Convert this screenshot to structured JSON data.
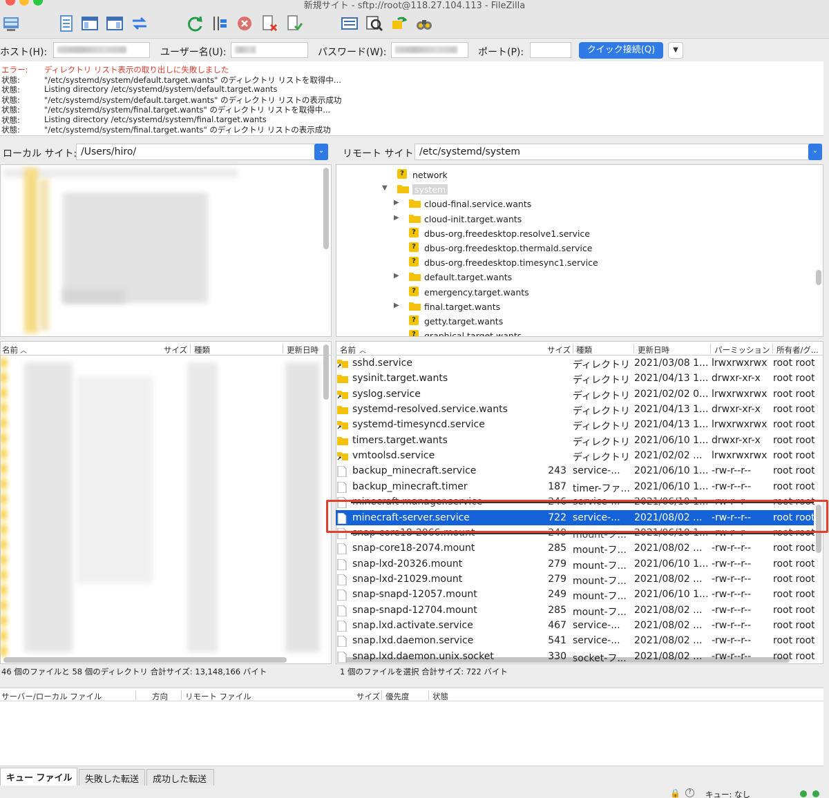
{
  "window": {
    "title": "新規サイト - sftp://root@118.27.104.113 - FileZilla"
  },
  "toolbar": {
    "icons": [
      "site-manager-icon",
      "message-log-icon",
      "local-tree-icon",
      "remote-tree-icon",
      "transfer-queue-icon",
      "refresh-icon",
      "process-queue-icon",
      "cancel-icon",
      "disconnect-icon",
      "reconnect-icon",
      "filter-icon",
      "compare-icon",
      "sync-browse-icon",
      "search-icon"
    ]
  },
  "quickconnect": {
    "host_label": "ホスト(H):",
    "user_label": "ユーザー名(U):",
    "password_label": "パスワード(W):",
    "port_label": "ポート(P):",
    "port_value": "",
    "connect_button": "クイック接続(Q)"
  },
  "log": [
    {
      "type": "エラー:",
      "msg": "ディレクトリ リスト表示の取り出しに失敗しました",
      "error": true
    },
    {
      "type": "状態:",
      "msg": "\"/etc/systemd/system/default.target.wants\" のディレクトリ リストを取得中...",
      "error": false
    },
    {
      "type": "状態:",
      "msg": "Listing directory /etc/systemd/system/default.target.wants",
      "error": false
    },
    {
      "type": "状態:",
      "msg": "\"/etc/systemd/system/default.target.wants\" のディレクトリ リストの表示成功",
      "error": false
    },
    {
      "type": "状態:",
      "msg": "\"/etc/systemd/system/final.target.wants\" のディレクトリ リストを取得中...",
      "error": false
    },
    {
      "type": "状態:",
      "msg": "Listing directory /etc/systemd/system/final.target.wants",
      "error": false
    },
    {
      "type": "状態:",
      "msg": "\"/etc/systemd/system/final.target.wants\" のディレクトリ リストの表示成功",
      "error": false
    }
  ],
  "local": {
    "site_label": "ローカル サイト:",
    "path": "/Users/hiro/",
    "columns": {
      "name": "名前",
      "size": "サイズ",
      "type": "種類",
      "modified": "更新日時"
    },
    "status": "46 個のファイルと 58 個のディレクトリ 合計サイズ: 13,148,166 バイト"
  },
  "remote": {
    "site_label": "リモート サイト:",
    "path": "/etc/systemd/system",
    "tree": [
      {
        "label": "network",
        "icon": "question",
        "indent": 0,
        "arrow": ""
      },
      {
        "label": "system",
        "icon": "folder",
        "indent": 0,
        "arrow": "down",
        "selected": true
      },
      {
        "label": "cloud-final.service.wants",
        "icon": "folder",
        "indent": 1,
        "arrow": "right"
      },
      {
        "label": "cloud-init.target.wants",
        "icon": "folder",
        "indent": 1,
        "arrow": "right"
      },
      {
        "label": "dbus-org.freedesktop.resolve1.service",
        "icon": "question",
        "indent": 1,
        "arrow": ""
      },
      {
        "label": "dbus-org.freedesktop.thermald.service",
        "icon": "question",
        "indent": 1,
        "arrow": ""
      },
      {
        "label": "dbus-org.freedesktop.timesync1.service",
        "icon": "question",
        "indent": 1,
        "arrow": ""
      },
      {
        "label": "default.target.wants",
        "icon": "folder",
        "indent": 1,
        "arrow": "right"
      },
      {
        "label": "emergency.target.wants",
        "icon": "question",
        "indent": 1,
        "arrow": ""
      },
      {
        "label": "final.target.wants",
        "icon": "folder",
        "indent": 1,
        "arrow": "right"
      },
      {
        "label": "getty.target.wants",
        "icon": "question",
        "indent": 1,
        "arrow": ""
      },
      {
        "label": "graphical.target.wants",
        "icon": "question",
        "indent": 1,
        "arrow": ""
      }
    ],
    "columns": {
      "name": "名前",
      "size": "サイズ",
      "type": "種類",
      "modified": "更新日時",
      "perms": "パーミッション",
      "owner": "所有者/グ..."
    },
    "files": [
      {
        "name": "sshd.service",
        "icon": "symlink",
        "size": "",
        "type": "ディレクトリ",
        "modified": "2021/03/08 1...",
        "perms": "lrwxrwxrwx",
        "owner": "root root"
      },
      {
        "name": "sysinit.target.wants",
        "icon": "folder",
        "size": "",
        "type": "ディレクトリ",
        "modified": "2021/04/13 1...",
        "perms": "drwxr-xr-x",
        "owner": "root root"
      },
      {
        "name": "syslog.service",
        "icon": "symlink",
        "size": "",
        "type": "ディレクトリ",
        "modified": "2021/02/02 0...",
        "perms": "lrwxrwxrwx",
        "owner": "root root"
      },
      {
        "name": "systemd-resolved.service.wants",
        "icon": "folder",
        "size": "",
        "type": "ディレクトリ",
        "modified": "2021/04/13 1...",
        "perms": "drwxr-xr-x",
        "owner": "root root"
      },
      {
        "name": "systemd-timesyncd.service",
        "icon": "symlink",
        "size": "",
        "type": "ディレクトリ",
        "modified": "2021/04/13 1...",
        "perms": "lrwxrwxrwx",
        "owner": "root root"
      },
      {
        "name": "timers.target.wants",
        "icon": "folder",
        "size": "",
        "type": "ディレクトリ",
        "modified": "2021/06/10 1...",
        "perms": "drwxr-xr-x",
        "owner": "root root"
      },
      {
        "name": "vmtoolsd.service",
        "icon": "symlink",
        "size": "",
        "type": "ディレクトリ",
        "modified": "2021/02/02 ...",
        "perms": "lrwxrwxrwx",
        "owner": "root root"
      },
      {
        "name": "backup_minecraft.service",
        "icon": "file",
        "size": "243",
        "type": "service-...",
        "modified": "2021/06/10 1...",
        "perms": "-rw-r--r--",
        "owner": "root root"
      },
      {
        "name": "backup_minecraft.timer",
        "icon": "file",
        "size": "187",
        "type": "timer-ファ...",
        "modified": "2021/06/10 1...",
        "perms": "-rw-r--r--",
        "owner": "root root"
      },
      {
        "name": "minecraft-manager.service",
        "icon": "file",
        "size": "246",
        "type": "service-...",
        "modified": "2021/06/10 1...",
        "perms": "-rw-r--r--",
        "owner": "root root",
        "strike": true
      },
      {
        "name": "minecraft-server.service",
        "icon": "file",
        "size": "722",
        "type": "service-...",
        "modified": "2021/08/02 ...",
        "perms": "-rw-r--r--",
        "owner": "root root",
        "selected": true
      },
      {
        "name": "snap-core18-2066.mount",
        "icon": "file",
        "size": "240",
        "type": "mount-フ...",
        "modified": "2021/06/10 1...",
        "perms": "-rw-r--r--",
        "owner": "root root",
        "strike": true
      },
      {
        "name": "snap-core18-2074.mount",
        "icon": "file",
        "size": "285",
        "type": "mount-フ...",
        "modified": "2021/08/02 ...",
        "perms": "-rw-r--r--",
        "owner": "root root"
      },
      {
        "name": "snap-lxd-20326.mount",
        "icon": "file",
        "size": "279",
        "type": "mount-フ...",
        "modified": "2021/06/10 1...",
        "perms": "-rw-r--r--",
        "owner": "root root"
      },
      {
        "name": "snap-lxd-21029.mount",
        "icon": "file",
        "size": "279",
        "type": "mount-フ...",
        "modified": "2021/08/02 ...",
        "perms": "-rw-r--r--",
        "owner": "root root"
      },
      {
        "name": "snap-snapd-12057.mount",
        "icon": "file",
        "size": "249",
        "type": "mount-フ...",
        "modified": "2021/06/10 1...",
        "perms": "-rw-r--r--",
        "owner": "root root"
      },
      {
        "name": "snap-snapd-12704.mount",
        "icon": "file",
        "size": "285",
        "type": "mount-フ...",
        "modified": "2021/08/02 ...",
        "perms": "-rw-r--r--",
        "owner": "root root"
      },
      {
        "name": "snap.lxd.activate.service",
        "icon": "file",
        "size": "467",
        "type": "service-...",
        "modified": "2021/08/02 ...",
        "perms": "-rw-r--r--",
        "owner": "root root"
      },
      {
        "name": "snap.lxd.daemon.service",
        "icon": "file",
        "size": "541",
        "type": "service-...",
        "modified": "2021/08/02 ...",
        "perms": "-rw-r--r--",
        "owner": "root root"
      },
      {
        "name": "snap.lxd.daemon.unix.socket",
        "icon": "file",
        "size": "330",
        "type": "socket-フ...",
        "modified": "2021/08/02 ...",
        "perms": "-rw-r--r--",
        "owner": "root root"
      }
    ],
    "status": "1 個のファイルを選択 合計サイズ: 722 バイト"
  },
  "queue": {
    "columns": {
      "server_file": "サーバー/ローカル ファイル",
      "direction": "方向",
      "remote_file": "リモート ファイル",
      "size": "サイズ",
      "priority": "優先度",
      "status": "状態"
    },
    "tabs": [
      "キュー ファイル",
      "失敗した転送",
      "成功した転送"
    ],
    "status": "キュー: なし"
  },
  "colors": {
    "accent": "#2f7ae5",
    "selection": "#1462d8",
    "error": "#e03a2a",
    "highlight": "#e0402c",
    "folder": "#f4c20d"
  }
}
